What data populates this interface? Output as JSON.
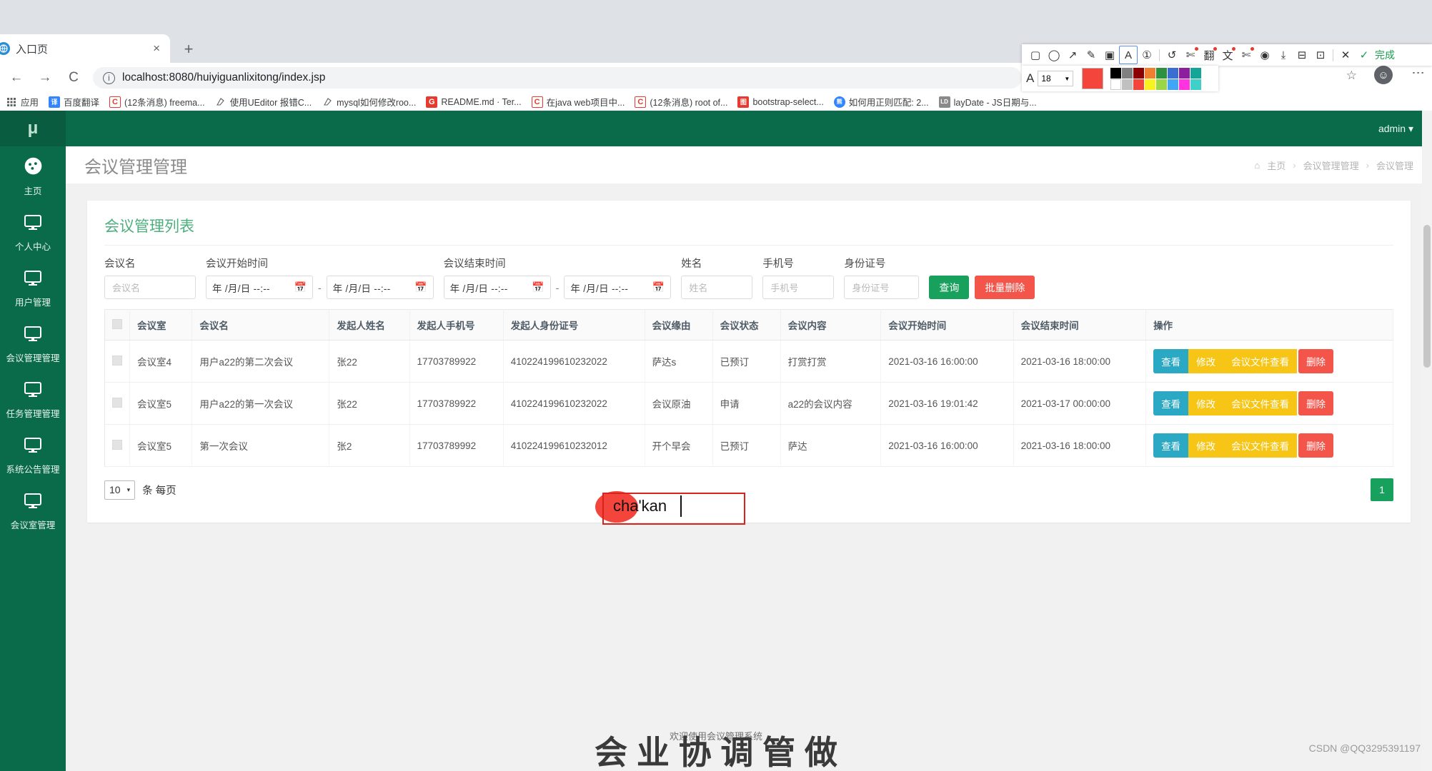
{
  "browser": {
    "tab": {
      "title": "入口页",
      "close_label": "×",
      "favicon": "globe-icon"
    },
    "newtab_label": "+",
    "nav": {
      "back": "←",
      "forward": "→",
      "reload": "C"
    },
    "omnibox": {
      "url": "localhost:8080/huiyiguanlixitong/index.jsp",
      "info_icon": "info-icon"
    },
    "star_label": "☆",
    "profile_label": "☺",
    "menu_label": "⋮",
    "bookmarks": [
      {
        "label": "应用",
        "icon_text": "",
        "color": "#ffffff"
      },
      {
        "label": "百度翻译",
        "icon_text": "译",
        "color": "#3385ff"
      },
      {
        "label": "(12条消息) freema...",
        "icon_text": "C",
        "color": "#ffffff"
      },
      {
        "label": "使用UEditor 报错C...",
        "icon_text": "",
        "color": "#ffffff"
      },
      {
        "label": "mysql如何修改roo...",
        "icon_text": "",
        "color": "#ffffff"
      },
      {
        "label": "README.md · Ter...",
        "icon_text": "G",
        "color": "#ffffff"
      },
      {
        "label": "在java web项目中...",
        "icon_text": "C",
        "color": "#ffffff"
      },
      {
        "label": "(12条消息) root of...",
        "icon_text": "C",
        "color": "#ffffff"
      },
      {
        "label": "bootstrap-select...",
        "icon_text": "图",
        "color": "#e8392e"
      },
      {
        "label": "如何用正则匹配: 2...",
        "icon_text": "",
        "color": "#ffffff"
      },
      {
        "label": "layDate - JS日期与...",
        "icon_text": "LD",
        "color": "#8a8a8a"
      }
    ]
  },
  "annotation_toolbar": {
    "tools": [
      {
        "name": "rectangle-tool",
        "glyph": "▢",
        "selected": false,
        "badge": false
      },
      {
        "name": "ellipse-tool",
        "glyph": "◯",
        "selected": false,
        "badge": false
      },
      {
        "name": "arrow-tool",
        "glyph": "↗",
        "selected": false,
        "badge": false
      },
      {
        "name": "pen-tool",
        "glyph": "✎",
        "selected": false,
        "badge": false
      },
      {
        "name": "mosaic-tool",
        "glyph": "▣",
        "selected": false,
        "badge": false
      },
      {
        "name": "text-tool",
        "glyph": "A",
        "selected": true,
        "badge": false
      },
      {
        "name": "serial-number-tool",
        "glyph": "①",
        "selected": false,
        "badge": false
      },
      {
        "name": "undo-tool",
        "glyph": "↺",
        "selected": false,
        "badge": false
      },
      {
        "name": "cut-tool",
        "glyph": "✄",
        "selected": false,
        "badge": true
      },
      {
        "name": "ocr-tool",
        "glyph": "翻",
        "selected": false,
        "badge": true
      },
      {
        "name": "translate-tool",
        "glyph": "文",
        "selected": false,
        "badge": true
      },
      {
        "name": "pin-tool",
        "glyph": "✄",
        "selected": false,
        "badge": true
      },
      {
        "name": "record-tool",
        "glyph": "◉",
        "selected": false,
        "badge": false
      },
      {
        "name": "download-tool",
        "glyph": "⤓",
        "selected": false,
        "badge": false
      },
      {
        "name": "save-tool",
        "glyph": "⊟",
        "selected": false,
        "badge": false
      },
      {
        "name": "bookmark-tool",
        "glyph": "⊡",
        "selected": false,
        "badge": false
      },
      {
        "name": "cancel-tool",
        "glyph": "✕",
        "selected": false,
        "badge": false
      },
      {
        "name": "confirm-tool",
        "glyph": "✓",
        "selected": false,
        "badge": false
      }
    ],
    "done_label": "完成",
    "font_glyph": "A",
    "font_size": "18",
    "dropdown_glyph": "▼",
    "current_color": "#f4453c",
    "palette": [
      "#000000",
      "#808080",
      "#8b0000",
      "#f08030",
      "#2e9142",
      "#3a6ed0",
      "#8b1f9e",
      "#13a598",
      "#ffffff",
      "#c0c0c0",
      "#f4453c",
      "#f8f320",
      "#9ad648",
      "#42a5f5",
      "#ff33e0",
      "#3fd0c9"
    ]
  },
  "app": {
    "brand": "μ",
    "sidebar": [
      {
        "label": "主页",
        "icon": "dashboard-icon"
      },
      {
        "label": "个人中心",
        "icon": "monitor-icon"
      },
      {
        "label": "用户管理",
        "icon": "monitor-icon"
      },
      {
        "label": "会议管理管理",
        "icon": "monitor-icon"
      },
      {
        "label": "任务管理管理",
        "icon": "monitor-icon"
      },
      {
        "label": "系统公告管理",
        "icon": "monitor-icon"
      },
      {
        "label": "会议室管理",
        "icon": "monitor-icon"
      }
    ],
    "topbar": {
      "user": "admin",
      "caret": "▾"
    },
    "page_title": "会议管理管理",
    "breadcrumb": {
      "home_icon": "home-icon",
      "items": [
        "主页",
        "会议管理管理",
        "会议管理"
      ],
      "sep": "›"
    },
    "panel_title": "会议管理列表",
    "search": {
      "meeting_name": {
        "label": "会议名",
        "placeholder": "会议名",
        "value": ""
      },
      "start_time": {
        "label": "会议开始时间",
        "from": {
          "text": "年 /月/日 --:--",
          "icon": "calendar-icon"
        },
        "to": {
          "text": "年 /月/日 --:--",
          "icon": "calendar-icon"
        },
        "dash": "-"
      },
      "end_time": {
        "label": "会议结束时间",
        "from": {
          "text": "年 /月/日 --:--",
          "icon": "calendar-icon"
        },
        "to": {
          "text": "年 /月/日 --:--",
          "icon": "calendar-icon"
        },
        "dash": "-"
      },
      "name": {
        "label": "姓名",
        "placeholder": "姓名",
        "value": ""
      },
      "phone": {
        "label": "手机号",
        "placeholder": "手机号",
        "value": ""
      },
      "idcard": {
        "label": "身份证号",
        "placeholder": "身份证号",
        "value": ""
      },
      "query_button": "查询",
      "batch_delete_button": "批量删除"
    },
    "table": {
      "columns": [
        "",
        "会议室",
        "会议名",
        "发起人姓名",
        "发起人手机号",
        "发起人身份证号",
        "会议缘由",
        "会议状态",
        "会议内容",
        "会议开始时间",
        "会议结束时间",
        "操作"
      ],
      "rows": [
        {
          "room": "会议室4",
          "meeting_name": "用户a22的第二次会议",
          "initiator_name": "张22",
          "initiator_phone": "17703789922",
          "initiator_id": "410224199610232022",
          "reason": "萨达s",
          "status": "已预订",
          "content": "打赏打赏",
          "start": "2021-03-16 16:00:00",
          "end": "2021-03-16 18:00:00"
        },
        {
          "room": "会议室5",
          "meeting_name": "用户a22的第一次会议",
          "initiator_name": "张22",
          "initiator_phone": "17703789922",
          "initiator_id": "410224199610232022",
          "reason": "会议原油",
          "status": "申请",
          "content": "a22的会议内容",
          "start": "2021-03-16 19:01:42",
          "end": "2021-03-17 00:00:00"
        },
        {
          "room": "会议室5",
          "meeting_name": "第一次会议",
          "initiator_name": "张2",
          "initiator_phone": "17703789992",
          "initiator_id": "410224199610232012",
          "reason": "开个早会",
          "status": "已预订",
          "content": "萨达",
          "start": "2021-03-16 16:00:00",
          "end": "2021-03-16 18:00:00"
        }
      ],
      "actions": {
        "view": "查看",
        "edit": "修改",
        "file": "会议文件查看",
        "delete": "删除"
      }
    },
    "footer": {
      "page_size": "10",
      "page_size_caret": "▾",
      "per_page_label": "条 每页",
      "current_page": "1"
    },
    "watermark_small": "欢迎使用会议管理系统",
    "watermark_big": "会 业 协 调 管 做",
    "csdn_watermark": "CSDN @QQ3295391197"
  },
  "ime_annotation": {
    "text": "cha'kan"
  }
}
